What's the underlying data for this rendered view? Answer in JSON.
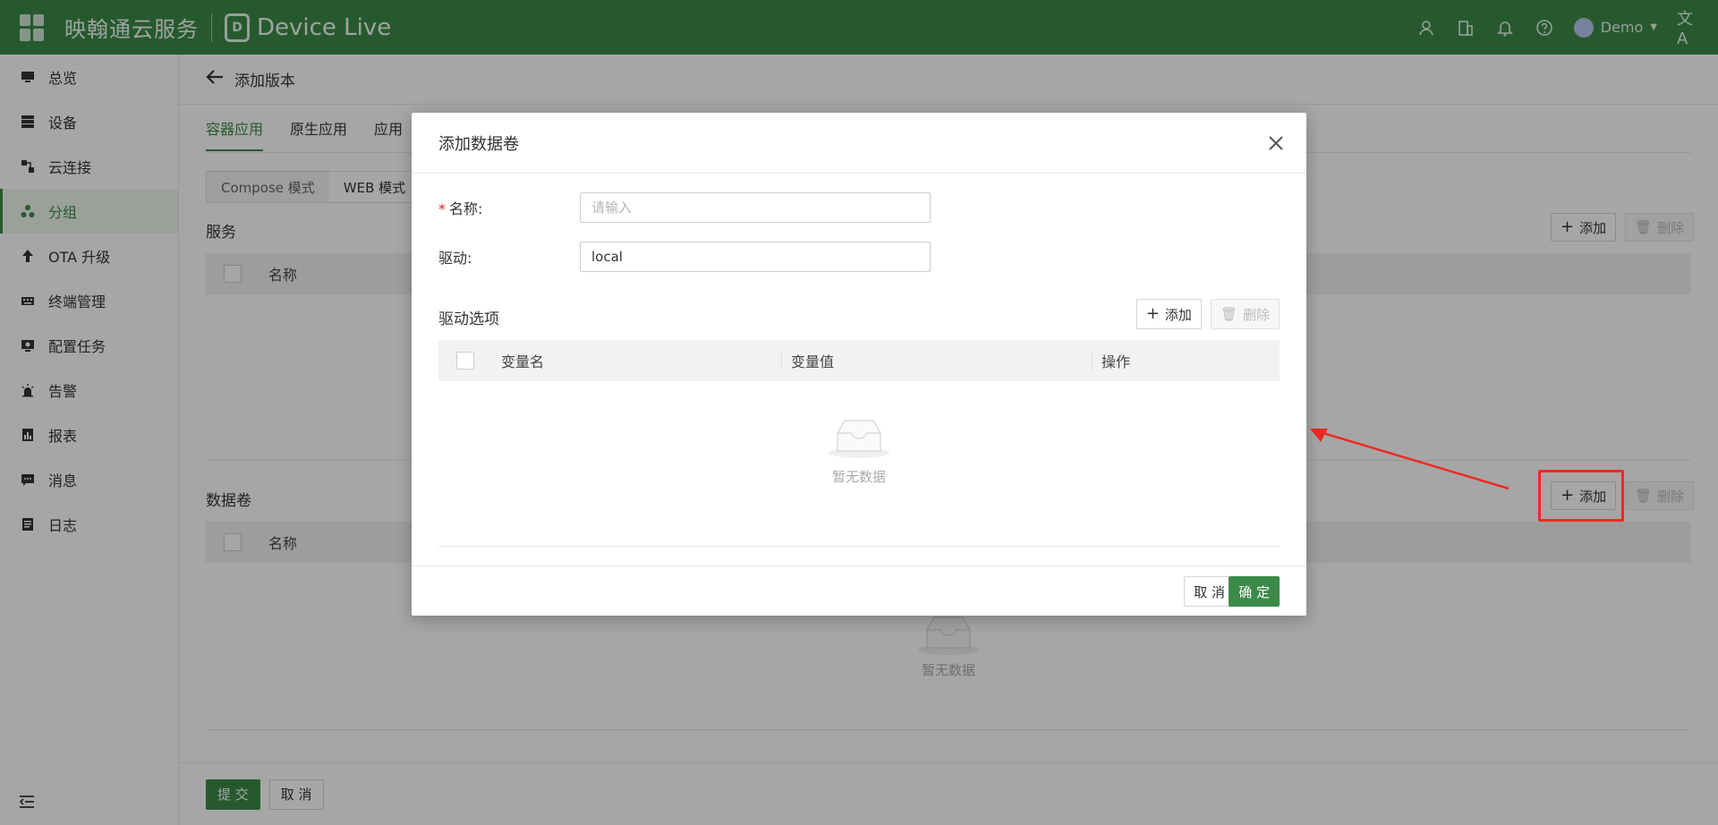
{
  "header": {
    "brand": "映翰通云服务",
    "product": "Device Live",
    "logo_letter": "D",
    "user_name": "Demo",
    "icons": [
      "user-icon",
      "building-icon",
      "bell-icon",
      "help-icon",
      "translate-icon"
    ]
  },
  "sidebar": {
    "items": [
      {
        "label": "总览",
        "icon": "monitor-icon"
      },
      {
        "label": "设备",
        "icon": "server-icon"
      },
      {
        "label": "云连接",
        "icon": "link-icon"
      },
      {
        "label": "分组",
        "icon": "group-icon",
        "active": true
      },
      {
        "label": "OTA 升级",
        "icon": "upload-icon"
      },
      {
        "label": "终端管理",
        "icon": "keyboard-icon"
      },
      {
        "label": "配置任务",
        "icon": "config-icon"
      },
      {
        "label": "告警",
        "icon": "alarm-icon"
      },
      {
        "label": "报表",
        "icon": "report-icon"
      },
      {
        "label": "消息",
        "icon": "message-icon"
      },
      {
        "label": "日志",
        "icon": "log-icon"
      }
    ]
  },
  "page": {
    "title": "添加版本",
    "tabs": [
      "容器应用",
      "原生应用",
      "应用"
    ],
    "modes": [
      "Compose 模式",
      "WEB 模式"
    ],
    "services_title": "服务",
    "volumes_title": "数据卷",
    "col_name": "名称",
    "add_label": "添加",
    "delete_label": "删除",
    "empty_text": "暂无数据",
    "submit_label": "提 交",
    "cancel_label": "取 消"
  },
  "modal": {
    "title": "添加数据卷",
    "name_label": "名称:",
    "name_placeholder": "请输入",
    "driver_label": "驱动:",
    "driver_value": "local",
    "options_title": "驱动选项",
    "add_label": "添加",
    "delete_label": "删除",
    "col_var_name": "变量名",
    "col_var_value": "变量值",
    "col_action": "操作",
    "empty_text": "暂无数据",
    "cancel_label": "取 消",
    "ok_label": "确 定"
  },
  "colors": {
    "brand_green": "#3b8a47",
    "annotation_red": "#ee2a24"
  }
}
